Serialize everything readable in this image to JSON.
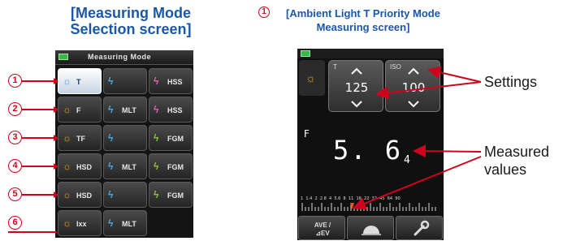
{
  "left": {
    "title_line1": "[Measuring Mode",
    "title_line2": "Selection screen]",
    "header_title": "Measuring Mode",
    "buttons": [
      [
        {
          "icon": "sun-icon",
          "label": "T"
        },
        {
          "icon": "flash-icon",
          "label": ""
        },
        {
          "icon": "flash-icon",
          "label": "HSS"
        }
      ],
      [
        {
          "icon": "sun-icon",
          "label": "F"
        },
        {
          "icon": "flash-icon",
          "label": "MLT"
        },
        {
          "icon": "flash-icon",
          "label": "HSS"
        }
      ],
      [
        {
          "icon": "sun-icon",
          "label": "TF"
        },
        {
          "icon": "flash-icon",
          "label": ""
        },
        {
          "icon": "flash-icon",
          "label": "FGM"
        }
      ],
      [
        {
          "icon": "sun-icon",
          "label": "HSD"
        },
        {
          "icon": "flash-icon",
          "label": "MLT"
        },
        {
          "icon": "flash-icon",
          "label": "FGM"
        }
      ],
      [
        {
          "icon": "sun-icon",
          "label": "HSD"
        },
        {
          "icon": "flash-icon",
          "label": ""
        },
        {
          "icon": "flash-icon",
          "label": "FGM"
        }
      ],
      [
        {
          "icon": "sun-icon",
          "label": "Ixx"
        },
        {
          "icon": "flash-icon",
          "label": "MLT"
        }
      ]
    ],
    "callouts": [
      "1",
      "2",
      "3",
      "4",
      "5",
      "6"
    ]
  },
  "right": {
    "callout": "1",
    "title_line1": "[Ambient Light T Priority Mode",
    "title_line2": "Measuring screen]",
    "t_caption": "T",
    "t_value": "125",
    "iso_caption": "ISO",
    "iso_value": "100",
    "f_label": "F",
    "measured_main": "5. 6",
    "measured_sub": "4",
    "scale_labels": [
      "1",
      "1.4",
      "2",
      "2.8",
      "4",
      "5.6",
      "8",
      "11",
      "16",
      "22",
      "32",
      "45",
      "64",
      "90"
    ],
    "btn_ave_line1": "AVE /",
    "btn_ave_line2": "⊿EV",
    "settings_label": "Settings",
    "measured_label_line1": "Measured",
    "measured_label_line2": "values"
  },
  "colors": {
    "title_blue": "#1a57a8",
    "callout_red": "#d0021b",
    "sun_orange": "#f5a623"
  }
}
